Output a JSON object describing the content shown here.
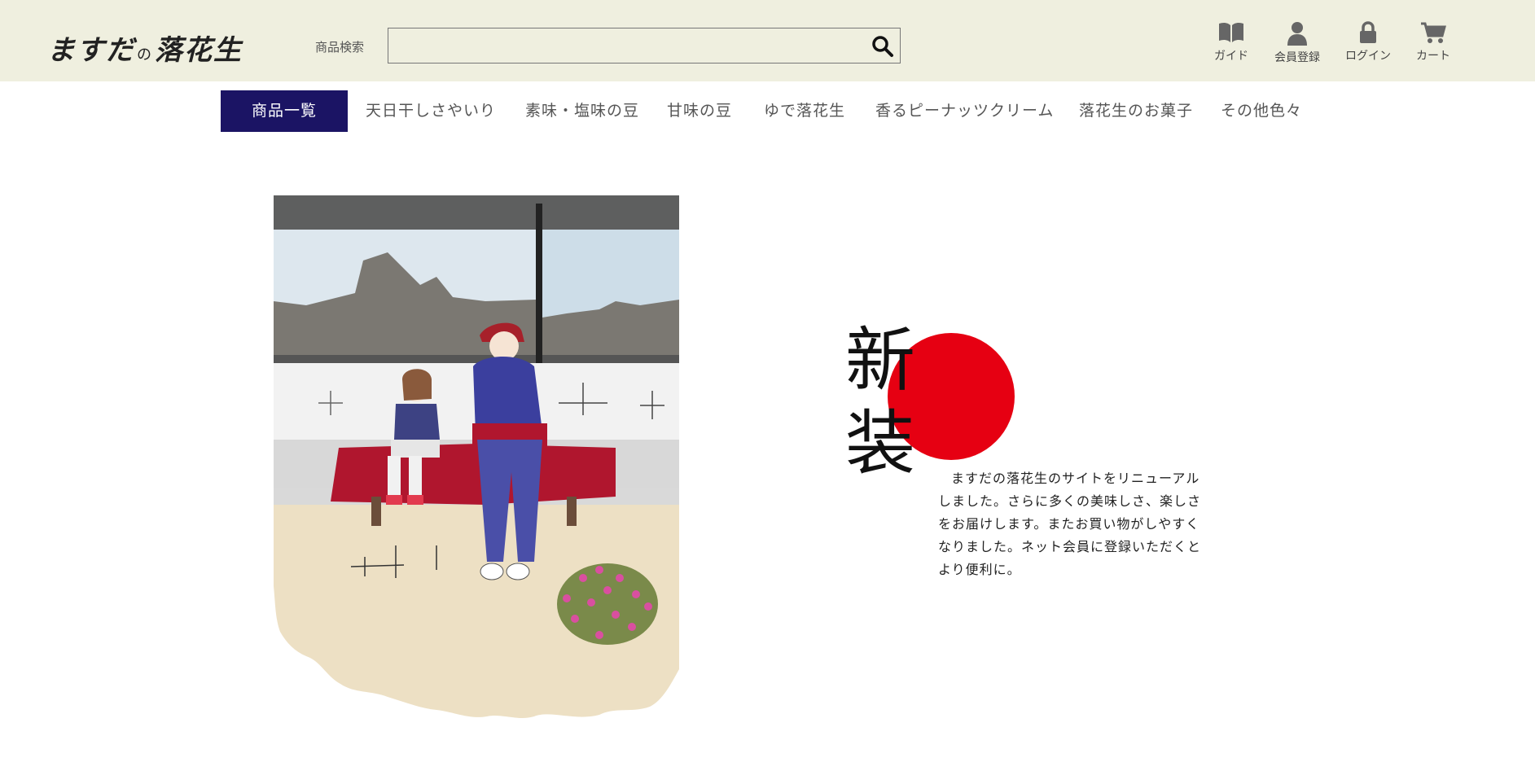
{
  "header": {
    "logo_main": "ますだ",
    "logo_no": "の",
    "logo_tail": "落花生",
    "search_label": "商品検索",
    "search_value": "",
    "search_placeholder": "",
    "icons": [
      {
        "icon": "book-icon",
        "label": "ガイド"
      },
      {
        "icon": "user-icon",
        "label": "会員登録"
      },
      {
        "icon": "lock-icon",
        "label": "ログイン"
      },
      {
        "icon": "cart-icon",
        "label": "カート"
      }
    ]
  },
  "nav": {
    "items": [
      {
        "label": "商品一覧",
        "active": true
      },
      {
        "label": "天日干しさやいり"
      },
      {
        "label": "素味・塩味の豆"
      },
      {
        "label": "甘味の豆"
      },
      {
        "label": "ゆで落花生"
      },
      {
        "label": "香るピーナッツクリーム"
      },
      {
        "label": "落花生のお菓子"
      },
      {
        "label": "その他色々"
      }
    ]
  },
  "hero": {
    "kanji_1": "新",
    "kanji_2": "装",
    "description": "ますだの落花生のサイトをリニューアルしました。さらに多くの美味しさ、楽しさをお届けします。またお買い物がしやすくなりました。ネット会員に登録いただくとより便利に。"
  },
  "colors": {
    "header_bg": "#efefdf",
    "nav_active": "#1b1464",
    "sun_red": "#e60012"
  }
}
